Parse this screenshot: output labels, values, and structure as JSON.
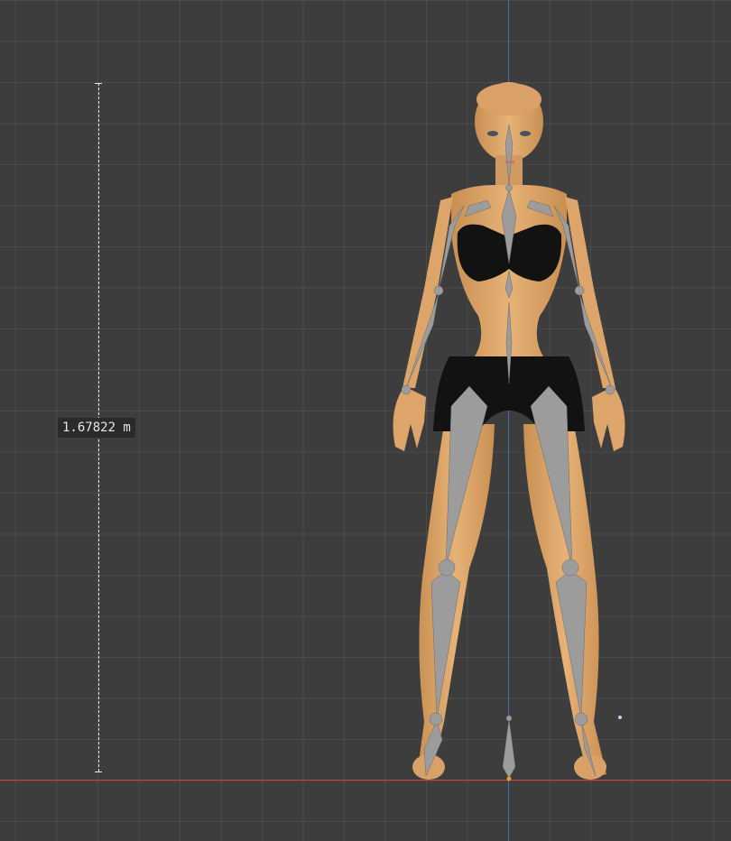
{
  "viewport": {
    "measurement_label": "1.67822 m",
    "colors": {
      "background": "#3d3d3d",
      "axis_x": "#c9424a",
      "axis_z": "#4a6fb0",
      "skin": "#dfa86a",
      "bone": "#9a9a9a",
      "clothing": "#111111"
    }
  }
}
